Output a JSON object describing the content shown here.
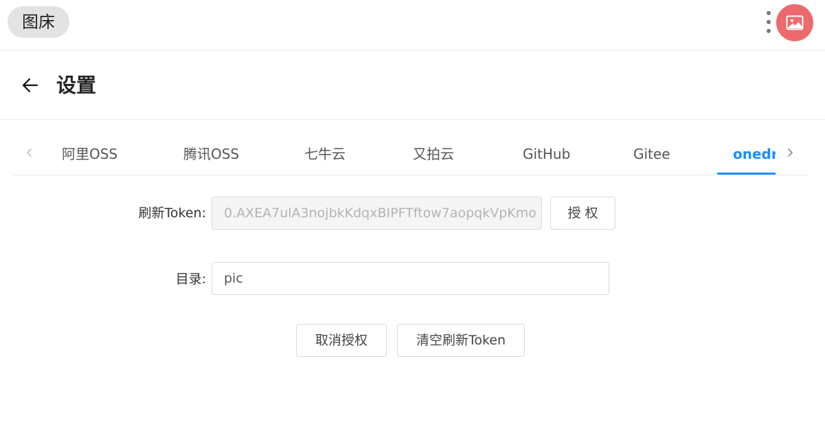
{
  "header": {
    "app_chip": "图床",
    "more_icon": "more-vertical-icon",
    "avatar_icon": "image-icon",
    "avatar_color": "#ec6a6e"
  },
  "page": {
    "title": "设置",
    "back_icon": "arrow-left-icon"
  },
  "tabs": {
    "items": [
      {
        "label": "阿里OSS"
      },
      {
        "label": "腾讯OSS"
      },
      {
        "label": "七牛云"
      },
      {
        "label": "又拍云"
      },
      {
        "label": "GitHub"
      },
      {
        "label": "Gitee"
      },
      {
        "label": "onedri"
      }
    ],
    "active": "onedri",
    "accent_color": "#1890ff",
    "prev_icon": "chevron-left-icon",
    "next_icon": "chevron-right-icon"
  },
  "form": {
    "refresh_token_label": "刷新Token:",
    "refresh_token_value": "0.AXEA7ulA3nojbkKdqxBIPFTftow7aopqkVpKmo",
    "authorize_button": "授权",
    "directory_label": "目录:",
    "directory_value": "pic",
    "cancel_auth_button": "取消授权",
    "clear_token_button": "清空刷新Token"
  }
}
